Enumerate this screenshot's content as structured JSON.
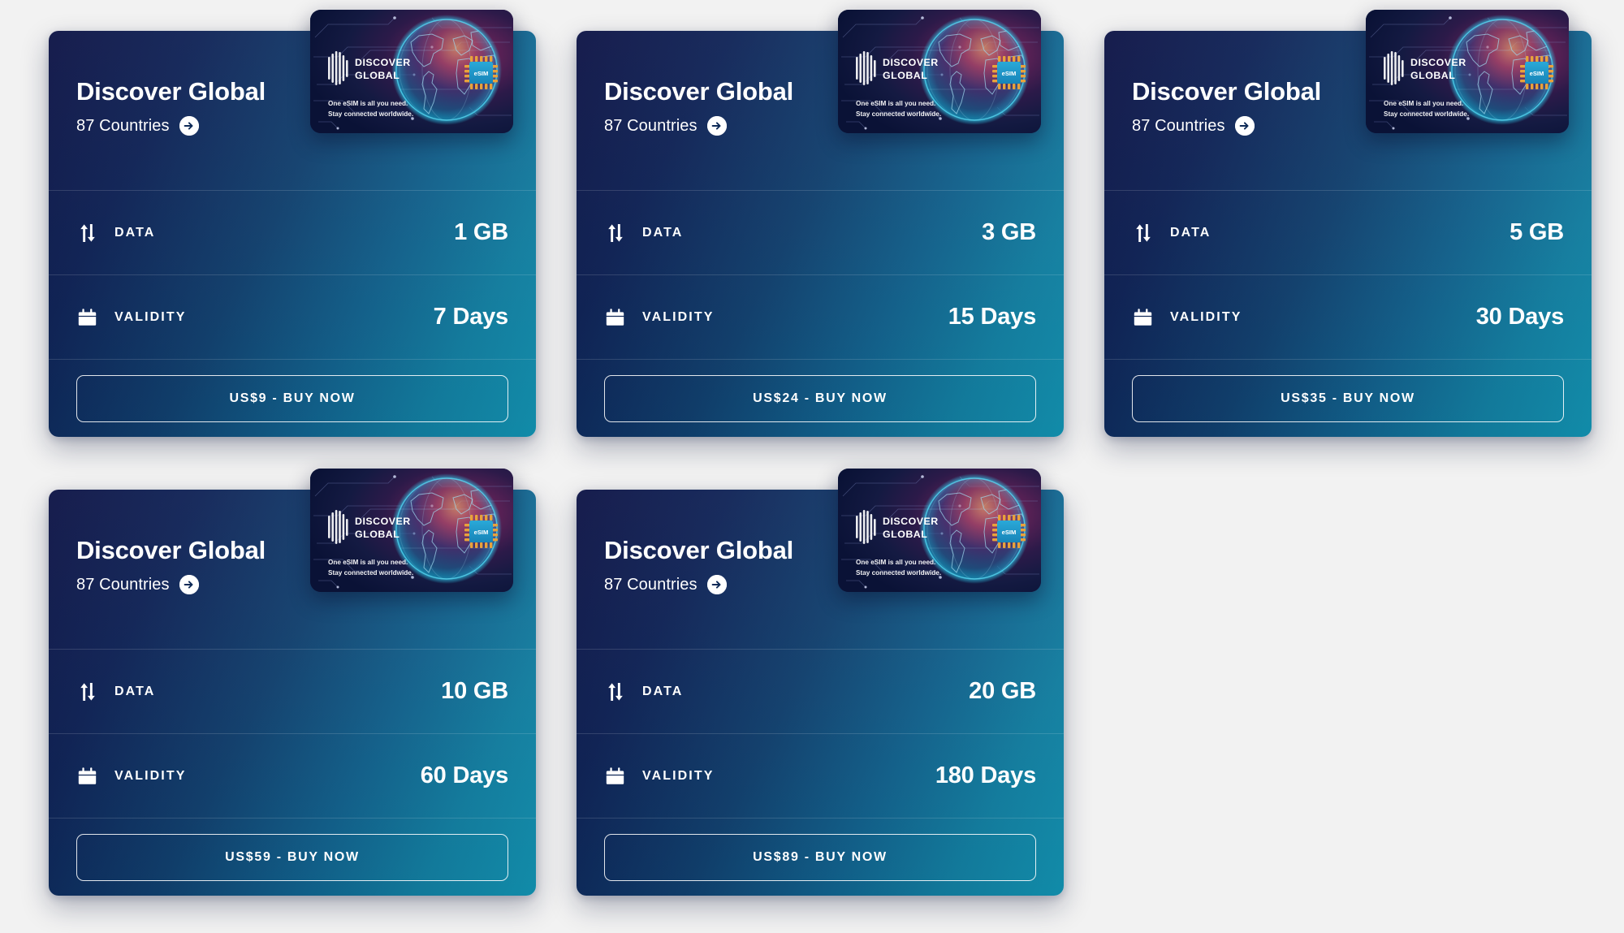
{
  "page": {
    "background_color": "#f2f2f2",
    "card_gradient_start": "#0b1144",
    "card_gradient_end": "#1294b3"
  },
  "labels": {
    "data_label": "DATA",
    "validity_label": "VALIDITY"
  },
  "artwork": {
    "brand_line1": "DISCOVER",
    "brand_line2": "GLOBAL",
    "tagline_line1": "One eSIM is all you need.",
    "tagline_line2": "Stay connected worldwide.",
    "chip_label": "eSIM"
  },
  "plans": [
    {
      "title": "Discover Global",
      "countries": "87 Countries",
      "data_label": "DATA",
      "data_value": "1 GB",
      "validity_label": "VALIDITY",
      "validity_value": "7 Days",
      "buy_label": "US$9 - BUY NOW",
      "price": "US$9"
    },
    {
      "title": "Discover Global",
      "countries": "87 Countries",
      "data_label": "DATA",
      "data_value": "3 GB",
      "validity_label": "VALIDITY",
      "validity_value": "15 Days",
      "buy_label": "US$24 - BUY NOW",
      "price": "US$24"
    },
    {
      "title": "Discover Global",
      "countries": "87 Countries",
      "data_label": "DATA",
      "data_value": "5 GB",
      "validity_label": "VALIDITY",
      "validity_value": "30 Days",
      "buy_label": "US$35 - BUY NOW",
      "price": "US$35"
    },
    {
      "title": "Discover Global",
      "countries": "87 Countries",
      "data_label": "DATA",
      "data_value": "10 GB",
      "validity_label": "VALIDITY",
      "validity_value": "60 Days",
      "buy_label": "US$59 - BUY NOW",
      "price": "US$59"
    },
    {
      "title": "Discover Global",
      "countries": "87 Countries",
      "data_label": "DATA",
      "data_value": "20 GB",
      "validity_label": "VALIDITY",
      "validity_value": "180 Days",
      "buy_label": "US$89 - BUY NOW",
      "price": "US$89"
    }
  ]
}
